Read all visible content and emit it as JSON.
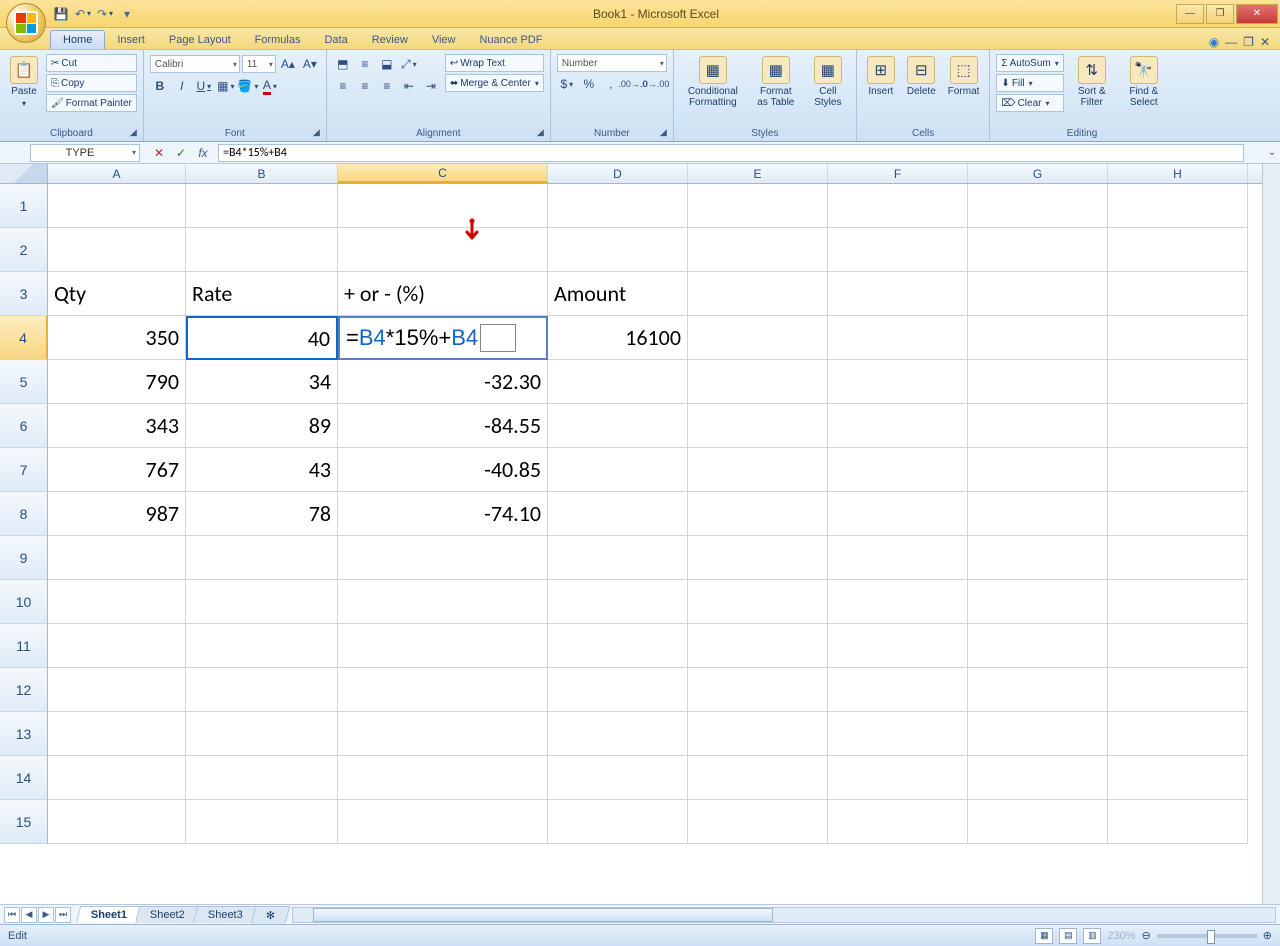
{
  "window": {
    "title": "Book1 - Microsoft Excel"
  },
  "qat": {
    "save": "💾",
    "undo": "↶",
    "redo": "↷"
  },
  "tabs": [
    "Home",
    "Insert",
    "Page Layout",
    "Formulas",
    "Data",
    "Review",
    "View",
    "Nuance PDF"
  ],
  "active_tab": "Home",
  "ribbon": {
    "clipboard": {
      "paste": "Paste",
      "cut": "Cut",
      "copy": "Copy",
      "fmtpaint": "Format Painter",
      "label": "Clipboard"
    },
    "font": {
      "name": "Calibri",
      "size": "11",
      "label": "Font",
      "bold": "B",
      "italic": "I",
      "underline": "U"
    },
    "alignment": {
      "wrap": "Wrap Text",
      "merge": "Merge & Center",
      "label": "Alignment"
    },
    "number": {
      "fmt": "Number",
      "label": "Number"
    },
    "styles": {
      "cond": "Conditional Formatting",
      "fmt_tbl": "Format as Table",
      "cell": "Cell Styles",
      "label": "Styles"
    },
    "cells": {
      "insert": "Insert",
      "delete": "Delete",
      "format": "Format",
      "label": "Cells"
    },
    "editing": {
      "autosum": "AutoSum",
      "fill": "Fill",
      "clear": "Clear",
      "sort": "Sort & Filter",
      "find": "Find & Select",
      "label": "Editing"
    }
  },
  "formula_bar": {
    "name_box": "TYPE",
    "formula": "=B4*15%+B4",
    "formula_tokens": [
      {
        "t": "=",
        "c": ""
      },
      {
        "t": "B4",
        "c": "tok-ref"
      },
      {
        "t": "*15%+",
        "c": ""
      },
      {
        "t": "B4",
        "c": "tok-ref"
      }
    ]
  },
  "columns": [
    "A",
    "B",
    "C",
    "D",
    "E",
    "F",
    "G",
    "H"
  ],
  "col_widths": [
    "cw-A",
    "cw-B",
    "cw-C",
    "cw-D",
    "cw-E",
    "cw-F",
    "cw-G",
    "cw-H"
  ],
  "active_col_index": 2,
  "row_count": 15,
  "active_row": 4,
  "ref_cell": {
    "row": 4,
    "col": 1
  },
  "editing_cell": {
    "row": 4,
    "col": 2
  },
  "cells": {
    "3": {
      "0": {
        "v": "Qty",
        "a": "l"
      },
      "1": {
        "v": "Rate",
        "a": "l"
      },
      "2": {
        "v": "+ or - (%)",
        "a": "l"
      },
      "3": {
        "v": "Amount",
        "a": "l"
      }
    },
    "4": {
      "0": {
        "v": "350",
        "a": "r"
      },
      "1": {
        "v": "40",
        "a": "r"
      },
      "2": {
        "v": "__FORMULA__",
        "a": "l"
      },
      "3": {
        "v": "16100",
        "a": "r"
      }
    },
    "5": {
      "0": {
        "v": "790",
        "a": "r"
      },
      "1": {
        "v": "34",
        "a": "r"
      },
      "2": {
        "v": "-32.30",
        "a": "r"
      }
    },
    "6": {
      "0": {
        "v": "343",
        "a": "r"
      },
      "1": {
        "v": "89",
        "a": "r"
      },
      "2": {
        "v": "-84.55",
        "a": "r"
      }
    },
    "7": {
      "0": {
        "v": "767",
        "a": "r"
      },
      "1": {
        "v": "43",
        "a": "r"
      },
      "2": {
        "v": "-40.85",
        "a": "r"
      }
    },
    "8": {
      "0": {
        "v": "987",
        "a": "r"
      },
      "1": {
        "v": "78",
        "a": "r"
      },
      "2": {
        "v": "-74.10",
        "a": "r"
      }
    }
  },
  "sheet_tabs": [
    "Sheet1",
    "Sheet2",
    "Sheet3"
  ],
  "active_sheet": 0,
  "status": {
    "mode": "Edit",
    "zoom": "230%"
  }
}
